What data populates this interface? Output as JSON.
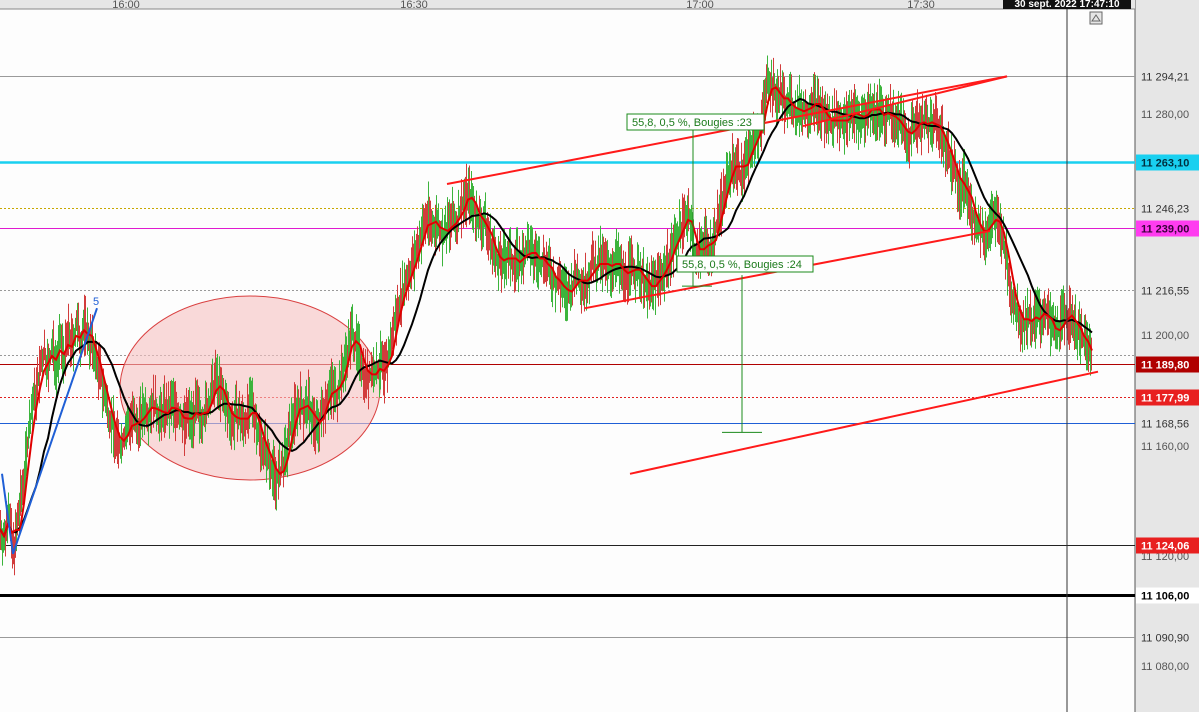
{
  "header": {
    "datetime": "30 sept. 2022 17:47:10"
  },
  "chart_data": {
    "type": "line",
    "title": "",
    "xlabel": "",
    "ylabel": "",
    "time_ticks": [
      "16:00",
      "16:30",
      "17:00",
      "17:30"
    ],
    "price_ticks": [
      "11 280,00",
      "11 200,00",
      "11 160,00",
      "11 120,00",
      "11 080,00"
    ],
    "ylim": [
      11070,
      11310
    ],
    "grid": false,
    "colors": {
      "background": "#fdfdfd",
      "axis_panel": "#e6e6e6",
      "candle_up": "#3cb43c",
      "candle_down": "#d23c3c",
      "ma_fast": "#e00000",
      "ma_slow": "#000000",
      "trendline": "#ff1a1a",
      "channel_line": "#ff1a1a",
      "wave_line": "#1f5fd6",
      "ellipse_fill": "#f6c2c2",
      "ellipse_stroke": "#d94040"
    },
    "levels": [
      {
        "value": 11294.21,
        "label": "11 294,21",
        "color": "#9a9a9a",
        "style": "solid",
        "label_bg": "#e6e6e6",
        "label_fg": "#333333"
      },
      {
        "value": 11263.1,
        "label": "11 263,10",
        "color": "#19d0f0",
        "style": "solid-thick",
        "label_bg": "#19d0f0",
        "label_fg": "#003040"
      },
      {
        "value": 11246.23,
        "label": "11 246,23",
        "color": "#c8a800",
        "style": "dotted",
        "label_bg": "#e6e6e6",
        "label_fg": "#333333"
      },
      {
        "value": 11239.0,
        "label": "11 239,00",
        "color": "#e01ad0",
        "style": "solid",
        "label_bg": "#ff3cf0",
        "label_fg": "#3a003a"
      },
      {
        "value": 11216.55,
        "label": "11 216,55",
        "color": "#999999",
        "style": "dotted",
        "label_bg": "#e6e6e6",
        "label_fg": "#333333"
      },
      {
        "value": 11193.0,
        "label": "",
        "color": "#999999",
        "style": "dotted",
        "label_bg": "",
        "label_fg": ""
      },
      {
        "value": 11189.8,
        "label": "11 189,80",
        "color": "#b00000",
        "style": "solid",
        "label_bg": "#b00000",
        "label_fg": "#ffffff"
      },
      {
        "value": 11177.99,
        "label": "11 177,99",
        "color": "#e02020",
        "style": "dotted",
        "label_bg": "#e82020",
        "label_fg": "#ffffff"
      },
      {
        "value": 11168.56,
        "label": "11 168,56",
        "color": "#1f5fd6",
        "style": "solid",
        "label_bg": "#e6e6e6",
        "label_fg": "#333333"
      },
      {
        "value": 11124.06,
        "label": "11 124,06",
        "color": "#222222",
        "style": "solid",
        "label_bg": "#e82020",
        "label_fg": "#ffffff"
      },
      {
        "value": 11106.0,
        "label": "11 106,00",
        "color": "#000000",
        "style": "solid-thick",
        "label_bg": "#ffffff",
        "label_fg": "#000000"
      },
      {
        "value": 11090.9,
        "label": "11 090,90",
        "color": "#9a9a9a",
        "style": "solid",
        "label_bg": "#e6e6e6",
        "label_fg": "#333333"
      }
    ],
    "annotations": [
      {
        "text": "55,8, 0,5 %, Bougies :23",
        "kind": "measure-box"
      },
      {
        "text": "55,8, 0,5 %, Bougies :24",
        "kind": "measure-box"
      },
      {
        "text": "5",
        "kind": "wave-label"
      }
    ],
    "price_path": [
      [
        0,
        11130
      ],
      [
        4,
        11125
      ],
      [
        8,
        11140
      ],
      [
        12,
        11121
      ],
      [
        16,
        11128
      ],
      [
        20,
        11140
      ],
      [
        24,
        11150
      ],
      [
        28,
        11165
      ],
      [
        32,
        11175
      ],
      [
        36,
        11180
      ],
      [
        40,
        11188
      ],
      [
        44,
        11194
      ],
      [
        48,
        11188
      ],
      [
        52,
        11196
      ],
      [
        56,
        11190
      ],
      [
        60,
        11198
      ],
      [
        64,
        11192
      ],
      [
        68,
        11200
      ],
      [
        72,
        11196
      ],
      [
        76,
        11204
      ],
      [
        80,
        11198
      ],
      [
        84,
        11204
      ],
      [
        88,
        11200
      ],
      [
        92,
        11196
      ],
      [
        96,
        11190
      ],
      [
        100,
        11186
      ],
      [
        104,
        11178
      ],
      [
        108,
        11172
      ],
      [
        112,
        11168
      ],
      [
        116,
        11162
      ],
      [
        120,
        11160
      ],
      [
        124,
        11164
      ],
      [
        128,
        11168
      ],
      [
        132,
        11170
      ],
      [
        136,
        11166
      ],
      [
        140,
        11170
      ],
      [
        144,
        11174
      ],
      [
        148,
        11172
      ],
      [
        152,
        11176
      ],
      [
        156,
        11173
      ],
      [
        160,
        11170
      ],
      [
        164,
        11174
      ],
      [
        168,
        11172
      ],
      [
        172,
        11176
      ],
      [
        176,
        11173
      ],
      [
        180,
        11170
      ],
      [
        184,
        11168
      ],
      [
        188,
        11172
      ],
      [
        192,
        11170
      ],
      [
        196,
        11174
      ],
      [
        200,
        11170
      ],
      [
        204,
        11172
      ],
      [
        208,
        11175
      ],
      [
        212,
        11180
      ],
      [
        216,
        11185
      ],
      [
        220,
        11180
      ],
      [
        224,
        11176
      ],
      [
        228,
        11172
      ],
      [
        232,
        11168
      ],
      [
        236,
        11172
      ],
      [
        240,
        11170
      ],
      [
        244,
        11168
      ],
      [
        248,
        11172
      ],
      [
        252,
        11176
      ],
      [
        256,
        11168
      ],
      [
        260,
        11162
      ],
      [
        264,
        11160
      ],
      [
        268,
        11156
      ],
      [
        272,
        11152
      ],
      [
        276,
        11148
      ],
      [
        280,
        11150
      ],
      [
        284,
        11155
      ],
      [
        288,
        11162
      ],
      [
        292,
        11170
      ],
      [
        296,
        11174
      ],
      [
        300,
        11176
      ],
      [
        304,
        11172
      ],
      [
        308,
        11176
      ],
      [
        312,
        11170
      ],
      [
        316,
        11166
      ],
      [
        320,
        11170
      ],
      [
        324,
        11175
      ],
      [
        328,
        11180
      ],
      [
        332,
        11182
      ],
      [
        336,
        11178
      ],
      [
        340,
        11184
      ],
      [
        344,
        11190
      ],
      [
        348,
        11196
      ],
      [
        352,
        11202
      ],
      [
        356,
        11196
      ],
      [
        360,
        11192
      ],
      [
        364,
        11186
      ],
      [
        368,
        11184
      ],
      [
        372,
        11188
      ],
      [
        376,
        11186
      ],
      [
        380,
        11190
      ],
      [
        384,
        11186
      ],
      [
        388,
        11192
      ],
      [
        392,
        11200
      ],
      [
        396,
        11208
      ],
      [
        400,
        11214
      ],
      [
        404,
        11218
      ],
      [
        408,
        11222
      ],
      [
        412,
        11226
      ],
      [
        416,
        11230
      ],
      [
        420,
        11236
      ],
      [
        424,
        11240
      ],
      [
        428,
        11244
      ],
      [
        432,
        11238
      ],
      [
        436,
        11242
      ],
      [
        440,
        11238
      ],
      [
        444,
        11236
      ],
      [
        448,
        11240
      ],
      [
        452,
        11242
      ],
      [
        456,
        11240
      ],
      [
        460,
        11246
      ],
      [
        464,
        11250
      ],
      [
        468,
        11252
      ],
      [
        472,
        11248
      ],
      [
        476,
        11244
      ],
      [
        480,
        11240
      ],
      [
        484,
        11242
      ],
      [
        488,
        11236
      ],
      [
        492,
        11232
      ],
      [
        496,
        11228
      ],
      [
        500,
        11226
      ],
      [
        504,
        11228
      ],
      [
        508,
        11230
      ],
      [
        512,
        11226
      ],
      [
        516,
        11228
      ],
      [
        520,
        11226
      ],
      [
        524,
        11230
      ],
      [
        528,
        11232
      ],
      [
        532,
        11228
      ],
      [
        536,
        11230
      ],
      [
        540,
        11226
      ],
      [
        544,
        11228
      ],
      [
        548,
        11224
      ],
      [
        552,
        11222
      ],
      [
        556,
        11218
      ],
      [
        560,
        11220
      ],
      [
        564,
        11216
      ],
      [
        568,
        11214
      ],
      [
        572,
        11218
      ],
      [
        576,
        11222
      ],
      [
        580,
        11220
      ],
      [
        584,
        11218
      ],
      [
        588,
        11222
      ],
      [
        592,
        11226
      ],
      [
        596,
        11224
      ],
      [
        600,
        11228
      ],
      [
        604,
        11226
      ],
      [
        608,
        11224
      ],
      [
        612,
        11226
      ],
      [
        616,
        11228
      ],
      [
        620,
        11224
      ],
      [
        624,
        11220
      ],
      [
        628,
        11224
      ],
      [
        632,
        11226
      ],
      [
        636,
        11222
      ],
      [
        640,
        11224
      ],
      [
        644,
        11220
      ],
      [
        648,
        11216
      ],
      [
        652,
        11218
      ],
      [
        656,
        11220
      ],
      [
        660,
        11222
      ],
      [
        664,
        11224
      ],
      [
        668,
        11228
      ],
      [
        672,
        11232
      ],
      [
        676,
        11236
      ],
      [
        680,
        11238
      ],
      [
        684,
        11242
      ],
      [
        688,
        11246
      ],
      [
        692,
        11236
      ],
      [
        696,
        11226
      ],
      [
        700,
        11232
      ],
      [
        704,
        11236
      ],
      [
        708,
        11230
      ],
      [
        712,
        11234
      ],
      [
        716,
        11240
      ],
      [
        720,
        11246
      ],
      [
        724,
        11252
      ],
      [
        728,
        11258
      ],
      [
        732,
        11262
      ],
      [
        736,
        11264
      ],
      [
        740,
        11258
      ],
      [
        744,
        11262
      ],
      [
        748,
        11266
      ],
      [
        752,
        11270
      ],
      [
        756,
        11272
      ],
      [
        760,
        11276
      ],
      [
        764,
        11284
      ],
      [
        768,
        11294
      ],
      [
        772,
        11290
      ],
      [
        776,
        11286
      ],
      [
        780,
        11288
      ],
      [
        784,
        11284
      ],
      [
        788,
        11286
      ],
      [
        792,
        11282
      ],
      [
        796,
        11280
      ],
      [
        800,
        11284
      ],
      [
        804,
        11280
      ],
      [
        808,
        11282
      ],
      [
        812,
        11286
      ],
      [
        816,
        11284
      ],
      [
        820,
        11282
      ],
      [
        824,
        11280
      ],
      [
        828,
        11278
      ],
      [
        832,
        11276
      ],
      [
        836,
        11280
      ],
      [
        840,
        11278
      ],
      [
        844,
        11276
      ],
      [
        848,
        11280
      ],
      [
        852,
        11282
      ],
      [
        856,
        11280
      ],
      [
        860,
        11278
      ],
      [
        864,
        11280
      ],
      [
        868,
        11282
      ],
      [
        872,
        11284
      ],
      [
        876,
        11280
      ],
      [
        880,
        11282
      ],
      [
        884,
        11278
      ],
      [
        888,
        11282
      ],
      [
        892,
        11280
      ],
      [
        896,
        11276
      ],
      [
        900,
        11278
      ],
      [
        904,
        11274
      ],
      [
        908,
        11270
      ],
      [
        912,
        11276
      ],
      [
        916,
        11278
      ],
      [
        920,
        11276
      ],
      [
        924,
        11278
      ],
      [
        928,
        11276
      ],
      [
        932,
        11278
      ],
      [
        936,
        11276
      ],
      [
        940,
        11274
      ],
      [
        944,
        11270
      ],
      [
        948,
        11266
      ],
      [
        952,
        11262
      ],
      [
        956,
        11258
      ],
      [
        960,
        11252
      ],
      [
        964,
        11256
      ],
      [
        968,
        11250
      ],
      [
        972,
        11244
      ],
      [
        976,
        11240
      ],
      [
        980,
        11238
      ],
      [
        984,
        11236
      ],
      [
        988,
        11240
      ],
      [
        992,
        11244
      ],
      [
        996,
        11242
      ],
      [
        1000,
        11238
      ],
      [
        1004,
        11232
      ],
      [
        1008,
        11222
      ],
      [
        1012,
        11214
      ],
      [
        1016,
        11208
      ],
      [
        1020,
        11206
      ],
      [
        1024,
        11204
      ],
      [
        1028,
        11208
      ],
      [
        1032,
        11204
      ],
      [
        1036,
        11208
      ],
      [
        1040,
        11206
      ],
      [
        1044,
        11210
      ],
      [
        1048,
        11206
      ],
      [
        1052,
        11202
      ],
      [
        1056,
        11200
      ],
      [
        1060,
        11204
      ],
      [
        1064,
        11208
      ],
      [
        1068,
        11206
      ],
      [
        1072,
        11208
      ],
      [
        1076,
        11202
      ],
      [
        1080,
        11200
      ],
      [
        1084,
        11198
      ],
      [
        1088,
        11196
      ],
      [
        1092,
        11190
      ]
    ]
  }
}
